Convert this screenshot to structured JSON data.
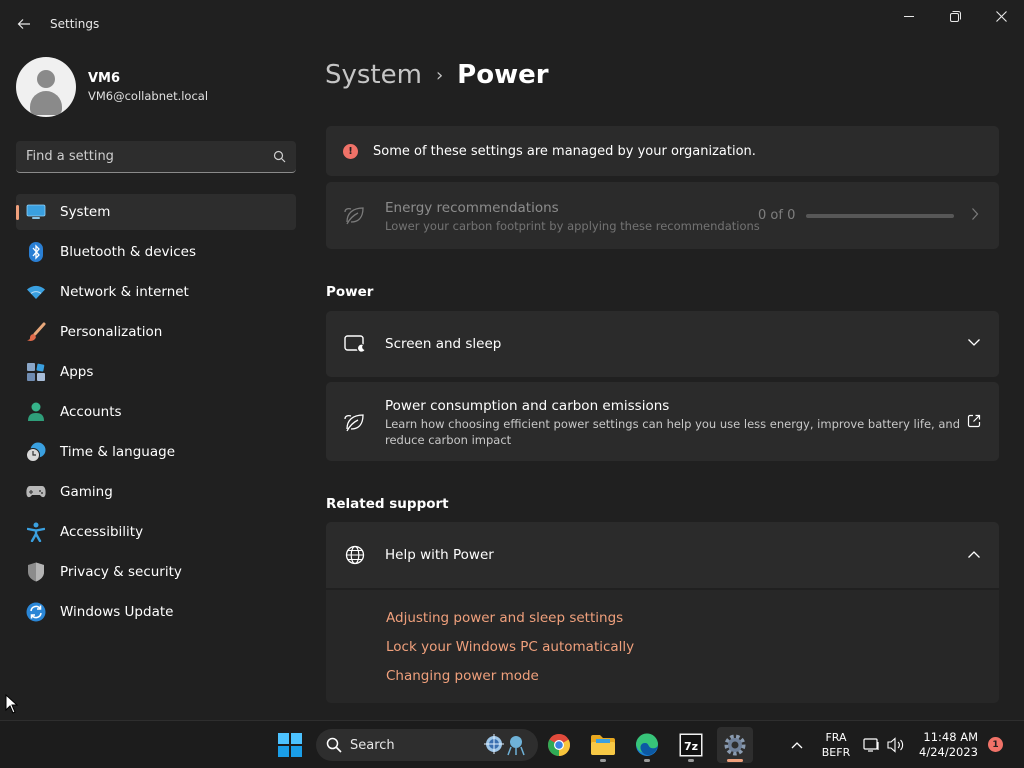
{
  "window": {
    "title": "Settings"
  },
  "profile": {
    "name": "VM6",
    "email": "VM6@collabnet.local"
  },
  "search": {
    "placeholder": "Find a setting"
  },
  "sidebar": {
    "items": [
      {
        "label": "System",
        "icon": "system-icon",
        "active": true
      },
      {
        "label": "Bluetooth & devices",
        "icon": "bluetooth-icon"
      },
      {
        "label": "Network & internet",
        "icon": "wifi-icon"
      },
      {
        "label": "Personalization",
        "icon": "brush-icon"
      },
      {
        "label": "Apps",
        "icon": "apps-icon"
      },
      {
        "label": "Accounts",
        "icon": "accounts-icon"
      },
      {
        "label": "Time & language",
        "icon": "clock-globe-icon"
      },
      {
        "label": "Gaming",
        "icon": "gamepad-icon"
      },
      {
        "label": "Accessibility",
        "icon": "accessibility-icon"
      },
      {
        "label": "Privacy & security",
        "icon": "shield-icon"
      },
      {
        "label": "Windows Update",
        "icon": "update-icon"
      }
    ]
  },
  "breadcrumb": {
    "parent": "System",
    "separator": "›",
    "current": "Power"
  },
  "banner": {
    "text": "Some of these settings are managed by your organization.",
    "icon": "info-icon"
  },
  "energy": {
    "title": "Energy recommendations",
    "subtitle": "Lower your carbon footprint by applying these recommendations",
    "count": "0 of 0",
    "progress": 0
  },
  "power_section": {
    "title": "Power",
    "screen_sleep": {
      "title": "Screen and sleep"
    },
    "consumption": {
      "title": "Power consumption and carbon emissions",
      "subtitle_line1": "Learn how choosing efficient power settings can help you use less energy, improve battery life, and",
      "subtitle_line2": "reduce carbon impact"
    }
  },
  "related": {
    "title": "Related support",
    "help": {
      "title": "Help with Power",
      "links": [
        "Adjusting power and sleep settings",
        "Lock your Windows PC automatically",
        "Changing power mode"
      ]
    }
  },
  "taskbar": {
    "search_label": "Search",
    "lang_line1": "FRA",
    "lang_line2": "BEFR",
    "time": "11:48 AM",
    "date": "4/24/2023",
    "notification_count": "1"
  },
  "colors": {
    "accent": "#f0a07c",
    "background": "#202020",
    "card": "#2b2b2b",
    "alert": "#f07268"
  }
}
